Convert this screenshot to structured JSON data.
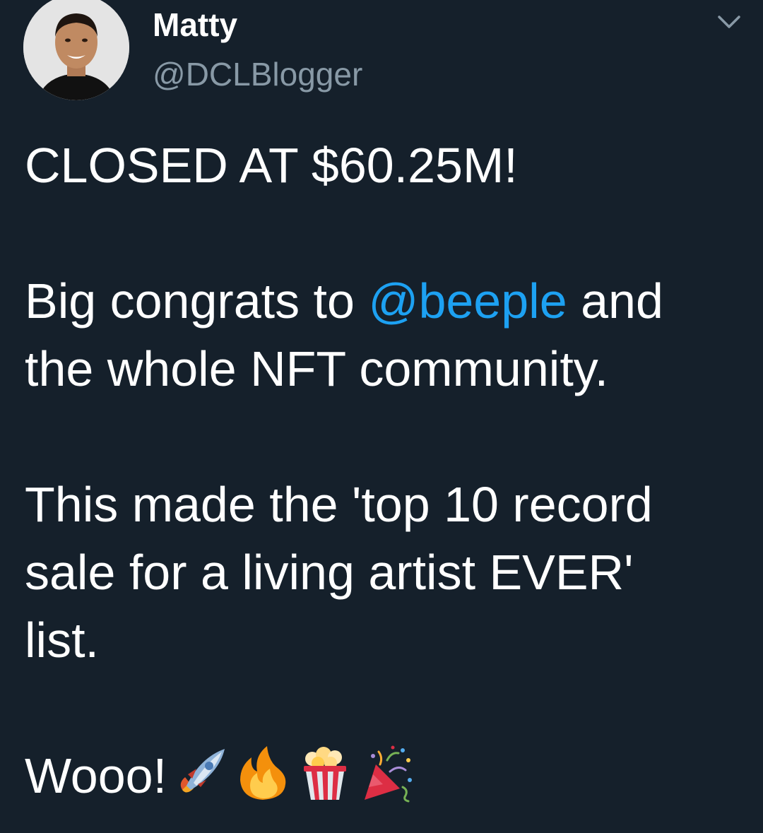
{
  "tweet": {
    "author": {
      "display_name": "Matty",
      "handle": "@DCLBlogger"
    },
    "lines": {
      "line1": "CLOSED AT $60.25M!",
      "line2_pre": "Big congrats to ",
      "line2_mention": "@beeple",
      "line2_post": " and",
      "line3": "the whole NFT community.",
      "line4": "This made the 'top 10 record",
      "line5": "sale for a living artist EVER'",
      "line6": "list.",
      "line7": "Wooo!"
    },
    "emojis": [
      "rocket-icon",
      "fire-icon",
      "popcorn-icon",
      "party-popper-icon"
    ],
    "colors": {
      "background": "#15202b",
      "text": "#ffffff",
      "secondary": "#8899a6",
      "link": "#1da1f2"
    }
  }
}
